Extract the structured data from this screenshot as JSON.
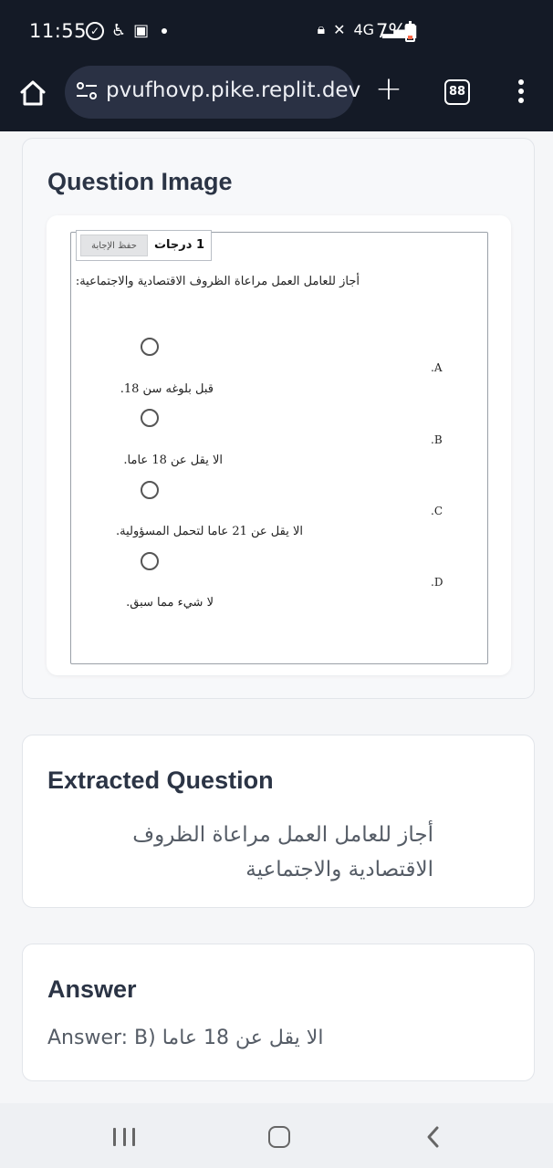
{
  "status_bar": {
    "time": "11:55",
    "network": "4G",
    "battery_percent": "7%",
    "battery_level": 0.07
  },
  "browser": {
    "url": "pvufhovp.pike.replit.dev",
    "tab_count": "88"
  },
  "question_image_card": {
    "title": "Question Image",
    "screenshot": {
      "save_label": "حفظ الإجابة",
      "grade": "1 درجات",
      "question": "أجاز للعامل العمل مراعاة الظروف الاقتصادية والاجتماعية:",
      "options": [
        {
          "letter": ".A",
          "text": "قبل بلوغه سن 18."
        },
        {
          "letter": ".B",
          "text": "الا يقل عن 18 عاما."
        },
        {
          "letter": ".C",
          "text": "الا يقل عن 21 عاما لتحمل المسؤولية."
        },
        {
          "letter": ".D",
          "text": "لا شيء مما سبق."
        }
      ]
    }
  },
  "extracted_card": {
    "title": "Extracted Question",
    "text": "أجاز للعامل العمل مراعاة الظروف الاقتصادية والاجتماعية"
  },
  "answer_card": {
    "title": "Answer",
    "text": "Answer: B) الا يقل عن 18 عاما"
  },
  "icons": {
    "home": "home-icon",
    "site_settings": "tune-icon",
    "new_tab": "plus-icon",
    "tabs": "tab-switcher-icon",
    "menu": "more-vert-icon"
  }
}
